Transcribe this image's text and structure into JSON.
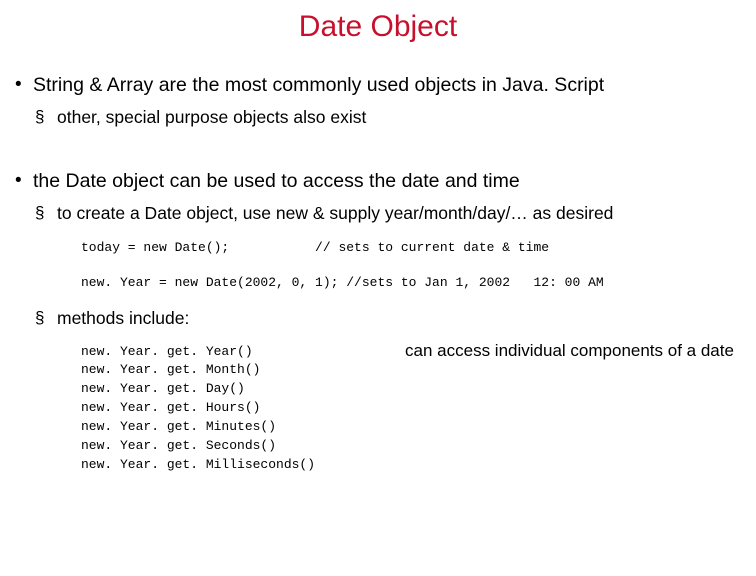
{
  "title": "Date Object",
  "bullets": {
    "b1": "String & Array are the most commonly used objects in Java. Script",
    "b1_sub1": "other, special purpose objects also exist",
    "b2": "the Date object can be used to access the date and time",
    "b2_sub1": "to create a Date object, use new & supply year/month/day/… as desired",
    "b2_sub2": "methods include:"
  },
  "code": {
    "line1": "today = new Date();           // sets to current date & time",
    "line2": "new. Year = new Date(2002, 0, 1); //sets to Jan 1, 2002   12: 00 AM"
  },
  "methods": "new. Year. get. Year()\nnew. Year. get. Month()\nnew. Year. get. Day()\nnew. Year. get. Hours()\nnew. Year. get. Minutes()\nnew. Year. get. Seconds()\nnew. Year. get. Milliseconds()",
  "methods_note": "can access individual components of a date"
}
